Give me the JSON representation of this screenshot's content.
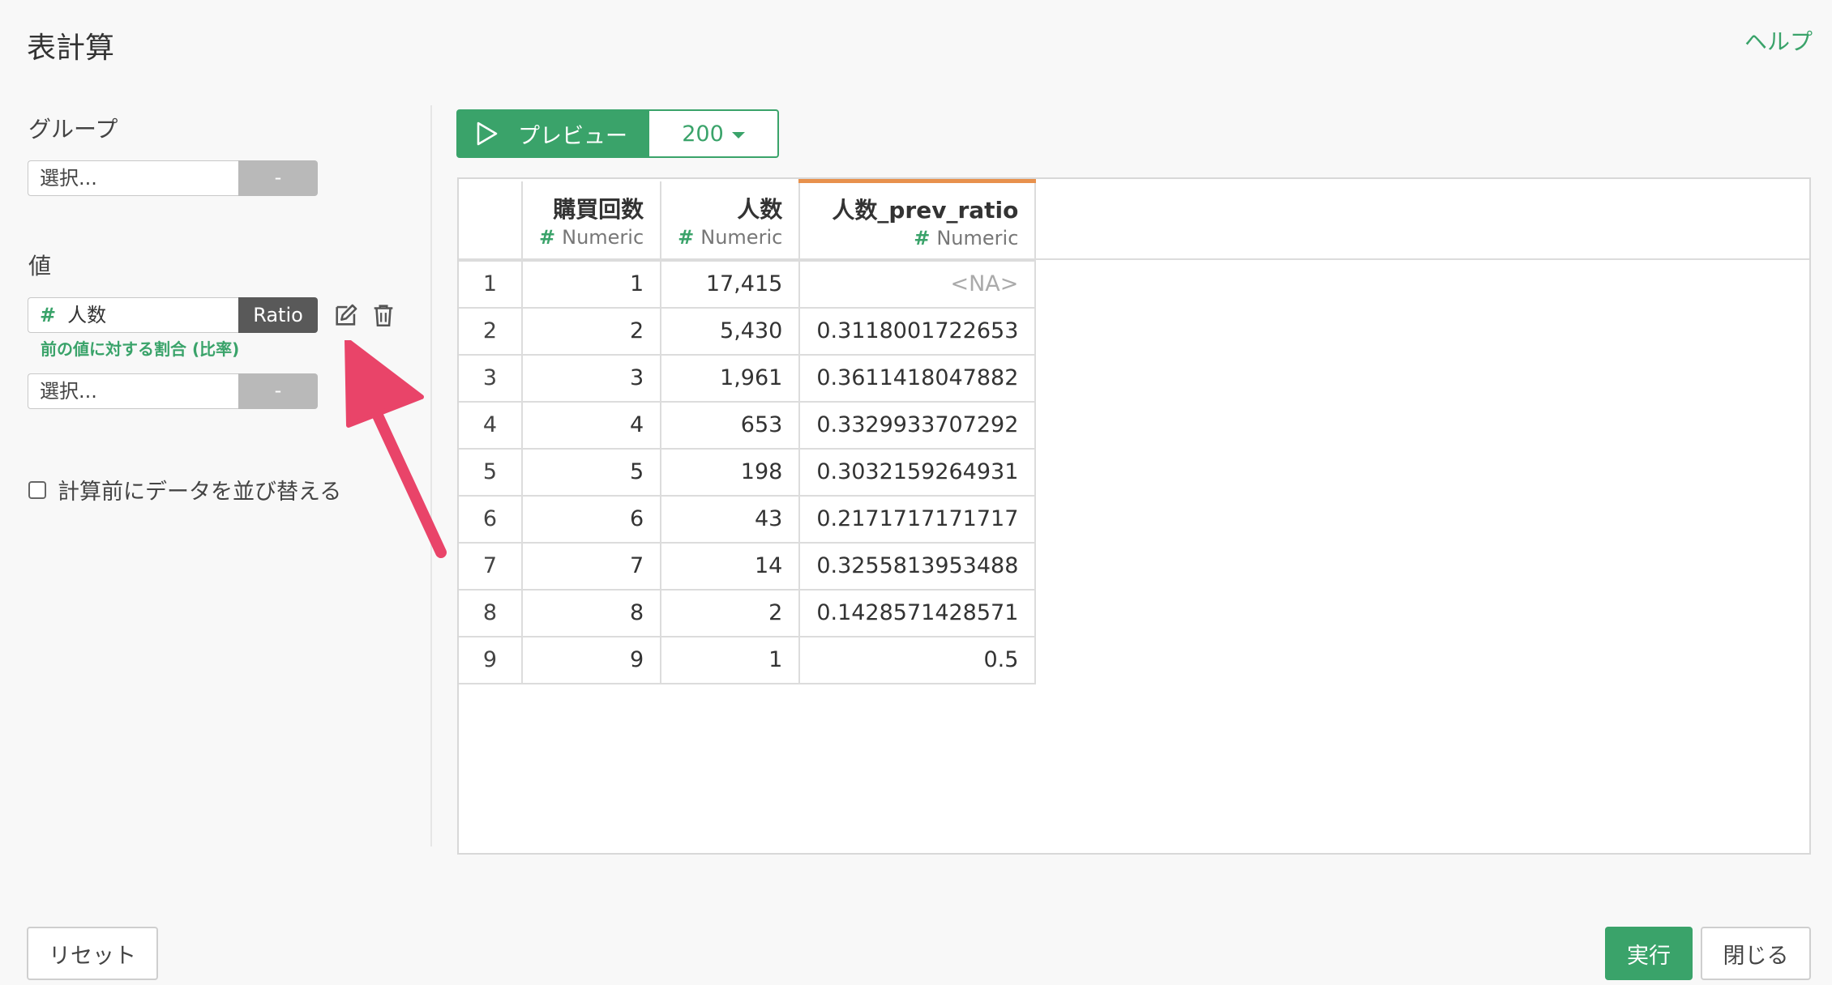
{
  "header": {
    "title": "表計算",
    "help_label": "ヘルプ"
  },
  "sidebar": {
    "group_label": "グループ",
    "group_select_placeholder": "選択...",
    "group_select_button": "-",
    "value_label": "値",
    "value_item": {
      "column": "人数",
      "type_button": "Ratio",
      "hint": "前の値に対する割合 (比率)"
    },
    "value_select_placeholder": "選択...",
    "value_select_button": "-",
    "sort_checkbox_label": "計算前にデータを並び替える"
  },
  "preview": {
    "button_label": "プレビュー",
    "row_count": "200"
  },
  "table": {
    "columns": [
      {
        "name": "購買回数",
        "type": "Numeric"
      },
      {
        "name": "人数",
        "type": "Numeric"
      },
      {
        "name": "人数_prev_ratio",
        "type": "Numeric"
      }
    ],
    "type_prefix": "#",
    "rows": [
      [
        "1",
        "1",
        "17,415",
        "<NA>"
      ],
      [
        "2",
        "2",
        "5,430",
        "0.3118001722653"
      ],
      [
        "3",
        "3",
        "1,961",
        "0.3611418047882"
      ],
      [
        "4",
        "4",
        "653",
        "0.3329933707292"
      ],
      [
        "5",
        "5",
        "198",
        "0.3032159264931"
      ],
      [
        "6",
        "6",
        "43",
        "0.2171717171717"
      ],
      [
        "7",
        "7",
        "14",
        "0.3255813953488"
      ],
      [
        "8",
        "8",
        "2",
        "0.1428571428571"
      ],
      [
        "9",
        "9",
        "1",
        "0.5"
      ]
    ]
  },
  "footer": {
    "reset_label": "リセット",
    "run_label": "実行",
    "close_label": "閉じる"
  },
  "colors": {
    "accent": "#3aa36a",
    "highlight_column": "#e8914d",
    "arrow": "#e94469"
  }
}
